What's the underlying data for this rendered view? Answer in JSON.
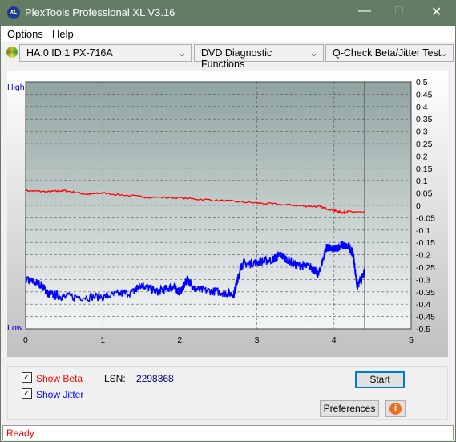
{
  "window": {
    "title": "PlexTools Professional XL V3.16",
    "logo_text": "XL"
  },
  "menu": [
    "Options",
    "Help"
  ],
  "toolbar": {
    "drive": "HA:0 ID:1  PX-716A",
    "category": "DVD Diagnostic Functions",
    "test": "Q-Check Beta/Jitter Test"
  },
  "chart_data": {
    "type": "line",
    "left_axis_labels": {
      "top": "High",
      "bottom": "Low"
    },
    "xlim": [
      0,
      5
    ],
    "ylim": [
      -0.5,
      0.5
    ],
    "x_ticks": [
      "0",
      "1",
      "2",
      "3",
      "4",
      "5"
    ],
    "y_ticks": [
      "0.5",
      "0.45",
      "0.4",
      "0.35",
      "0.3",
      "0.25",
      "0.2",
      "0.15",
      "0.1",
      "0.05",
      "0",
      "-0.05",
      "-0.1",
      "-0.15",
      "-0.2",
      "-0.25",
      "-0.3",
      "-0.35",
      "-0.4",
      "-0.45",
      "-0.5"
    ],
    "grid": true,
    "cursor_x": 4.4,
    "series": [
      {
        "name": "Beta",
        "color": "#ff0000",
        "x": [
          0,
          0.3,
          0.5,
          0.8,
          1.0,
          1.5,
          2.0,
          2.5,
          3.0,
          3.5,
          3.8,
          4.0,
          4.1,
          4.2,
          4.4
        ],
        "y": [
          0.06,
          0.055,
          0.06,
          0.045,
          0.05,
          0.035,
          0.03,
          0.02,
          0.01,
          0.0,
          -0.005,
          -0.02,
          -0.03,
          -0.025,
          -0.03
        ]
      },
      {
        "name": "Jitter",
        "color": "#0000ff",
        "x": [
          0,
          0.2,
          0.3,
          0.5,
          1.0,
          1.4,
          1.5,
          1.7,
          1.9,
          2.0,
          2.1,
          2.2,
          2.5,
          2.7,
          2.75,
          2.8,
          3.0,
          3.2,
          3.3,
          3.5,
          3.7,
          3.8,
          3.9,
          4.0,
          4.1,
          4.2,
          4.25,
          4.3,
          4.4
        ],
        "y": [
          -0.3,
          -0.32,
          -0.36,
          -0.37,
          -0.37,
          -0.35,
          -0.32,
          -0.35,
          -0.33,
          -0.35,
          -0.3,
          -0.34,
          -0.35,
          -0.36,
          -0.3,
          -0.24,
          -0.23,
          -0.22,
          -0.2,
          -0.24,
          -0.25,
          -0.28,
          -0.17,
          -0.18,
          -0.16,
          -0.17,
          -0.2,
          -0.33,
          -0.27
        ]
      }
    ]
  },
  "controls": {
    "show_beta": "Show Beta",
    "show_jitter": "Show Jitter",
    "show_beta_checked": true,
    "show_jitter_checked": true,
    "lsn_label": "LSN:",
    "lsn_value": "2298368",
    "start": "Start",
    "preferences": "Preferences"
  },
  "status": "Ready"
}
